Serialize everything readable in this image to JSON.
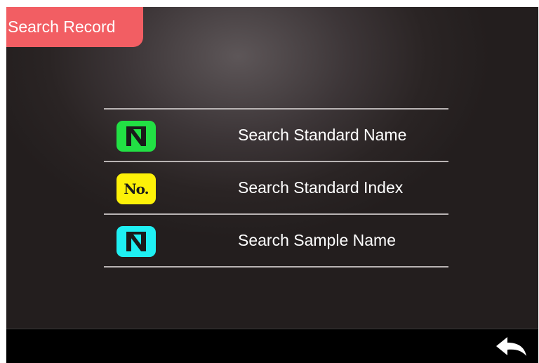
{
  "header": {
    "title": "Search Record"
  },
  "menu": {
    "items": [
      {
        "label": "Search Standard Name",
        "icon": "standard-name-icon",
        "icon_color": "#22e044"
      },
      {
        "label": "Search Standard Index",
        "icon": "index-number-icon",
        "icon_text": "No.",
        "icon_color": "#fdf108"
      },
      {
        "label": "Search Sample Name",
        "icon": "sample-name-icon",
        "icon_color": "#1ff0f3"
      }
    ]
  },
  "footer": {
    "back_icon": "back-arrow-icon"
  },
  "colors": {
    "title_tab": "#f25e63",
    "divider": "#b9b4b4",
    "footer": "#000000"
  }
}
